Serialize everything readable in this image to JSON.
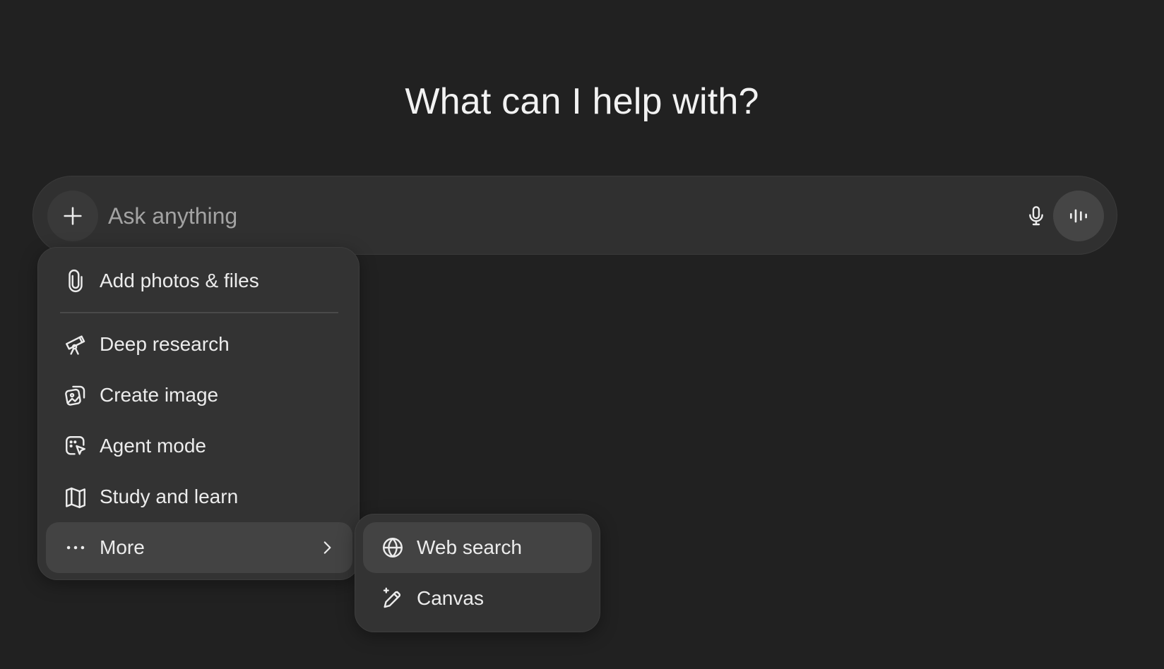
{
  "headline": "What can I help with?",
  "composer": {
    "placeholder": "Ask anything",
    "icons": [
      "plus-icon",
      "microphone-icon",
      "voice-mode-icon"
    ]
  },
  "menu": {
    "items": [
      {
        "label": "Add photos & files",
        "icon": "paperclip-icon"
      },
      {
        "label": "Deep research",
        "icon": "telescope-icon"
      },
      {
        "label": "Create image",
        "icon": "image-icon"
      },
      {
        "label": "Agent mode",
        "icon": "agent-cursor-icon"
      },
      {
        "label": "Study and learn",
        "icon": "book-icon"
      },
      {
        "label": "More",
        "icon": "ellipsis-icon",
        "has_submenu": true
      }
    ]
  },
  "submenu": {
    "items": [
      {
        "label": "Web search",
        "icon": "globe-icon"
      },
      {
        "label": "Canvas",
        "icon": "pencil-sparkle-icon"
      }
    ]
  },
  "colors": {
    "background": "#212121",
    "composer": "#303030",
    "menu": "#333333",
    "highlight": "#434343",
    "text": "#ececec",
    "placeholder": "#a3a3a3"
  }
}
